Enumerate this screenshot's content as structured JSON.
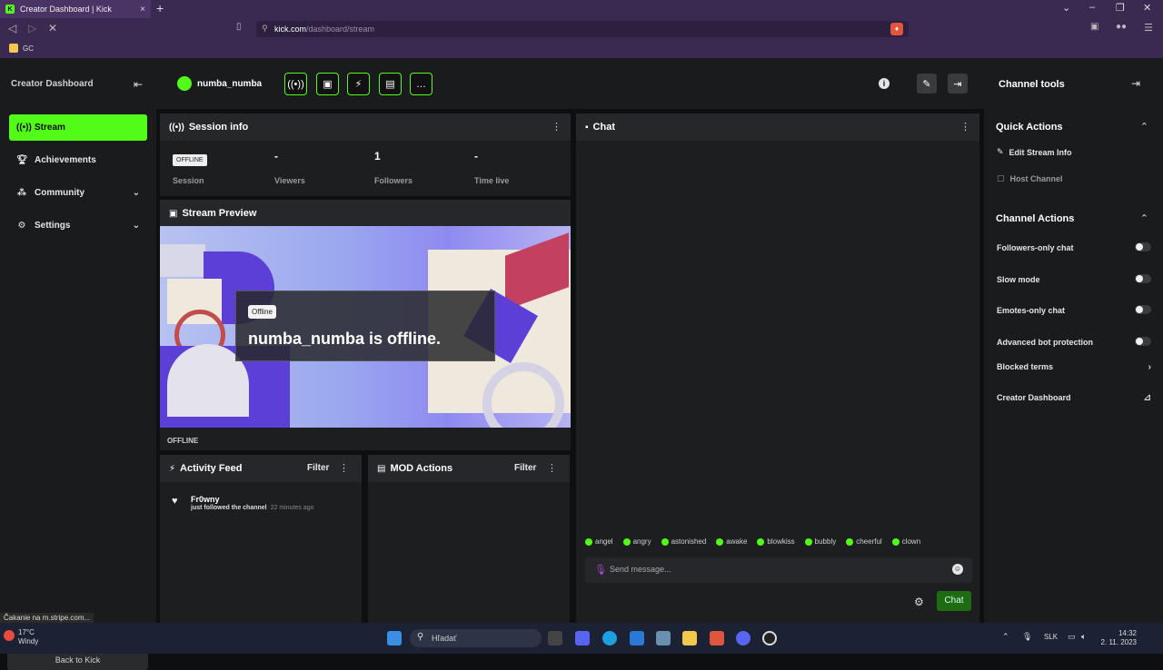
{
  "browser": {
    "tab_title": "Creator Dashboard | Kick",
    "tab_favicon": "K",
    "url_host": "kick.com",
    "url_path": "/dashboard/stream",
    "bookmark": "GC",
    "status_text": "Čakanie na m.stripe.com..."
  },
  "header": {
    "dashboard_title": "Creator Dashboard",
    "username": "numba_numba",
    "channel_tools_title": "Channel tools"
  },
  "sidebar": {
    "items": [
      {
        "label": "Stream",
        "icon": "broadcast-icon"
      },
      {
        "label": "Achievements",
        "icon": "trophy-icon"
      },
      {
        "label": "Community",
        "icon": "community-icon"
      },
      {
        "label": "Settings",
        "icon": "gear-icon"
      }
    ],
    "back_label": "Back to Kick"
  },
  "session": {
    "title": "Session info",
    "status_badge": "OFFLINE",
    "stats": [
      {
        "value": "",
        "label": "Session"
      },
      {
        "value": "-",
        "label": "Viewers"
      },
      {
        "value": "1",
        "label": "Followers"
      },
      {
        "value": "-",
        "label": "Time live"
      }
    ]
  },
  "preview": {
    "title": "Stream Preview",
    "badge": "Offline",
    "message": "numba_numba is offline.",
    "status": "OFFLINE"
  },
  "activity": {
    "title": "Activity Feed",
    "filter": "Filter",
    "items": [
      {
        "name": "Fr0wny",
        "text": "just followed the channel",
        "time": "22 minutes ago"
      }
    ]
  },
  "mod": {
    "title": "MOD Actions",
    "filter": "Filter"
  },
  "chat": {
    "title": "Chat",
    "emotes": [
      "angel",
      "angry",
      "astonished",
      "awake",
      "blowkiss",
      "bubbly",
      "cheerful",
      "clown"
    ],
    "placeholder": "Send message...",
    "send_label": "Chat"
  },
  "tools": {
    "quick_actions_title": "Quick Actions",
    "quick_actions": [
      "Edit Stream Info",
      "Host Channel"
    ],
    "channel_actions_title": "Channel Actions",
    "toggles": [
      "Followers-only chat",
      "Slow mode",
      "Emotes-only chat",
      "Advanced bot protection"
    ],
    "links": [
      "Blocked terms",
      "Creator Dashboard"
    ]
  },
  "taskbar": {
    "temperature": "17°C",
    "weather": "Windy",
    "search_placeholder": "Hľadať",
    "language": "SLK",
    "time": "14:32",
    "date": "2. 11. 2023"
  },
  "colors": {
    "accent": "#53fc18",
    "panel": "#1d1e20",
    "header": "#26272a"
  }
}
